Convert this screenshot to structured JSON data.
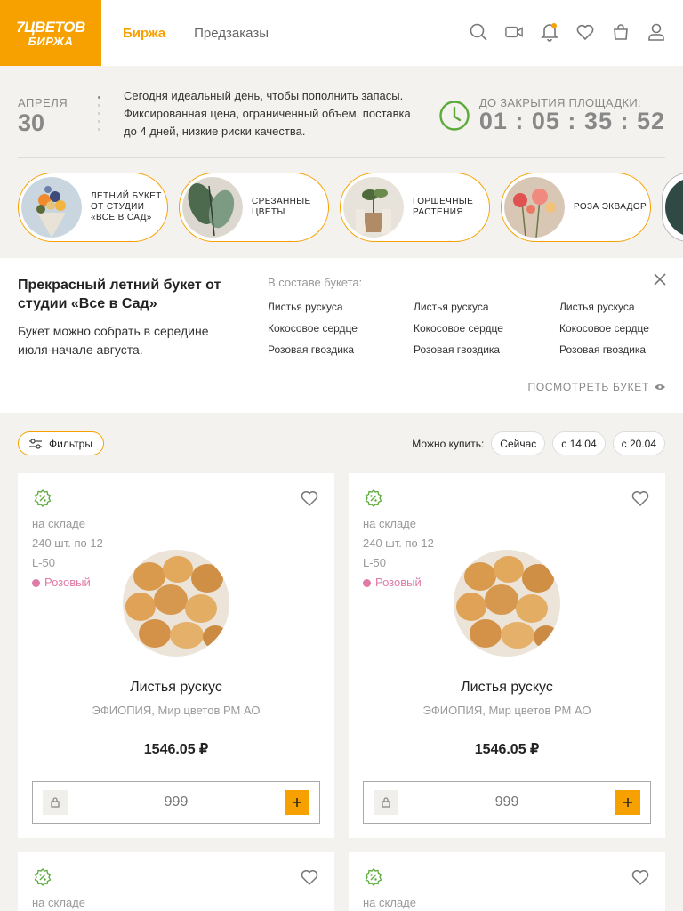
{
  "brand": {
    "line1": "7ЦВЕТОВ",
    "line2": "БИРЖА",
    "accent": "#f7a100"
  },
  "nav": {
    "tabs": [
      {
        "label": "Биржа",
        "active": true
      },
      {
        "label": "Предзаказы",
        "active": false
      }
    ]
  },
  "header_icons": [
    "search-icon",
    "video-icon",
    "bell-icon",
    "heart-icon",
    "cart-icon",
    "user-icon"
  ],
  "info": {
    "month": "АПРЕЛЯ",
    "day": "30",
    "description": "Сегодня идеальный день, чтобы пополнить запасы. Фиксированная цена, ограниченный объем, поставка до 4 дней, низкие риски качества.",
    "timer_label": "ДО ЗАКРЫТИЯ ПЛОЩАДКИ:",
    "timer_value": "01 : 05 : 35 : 52"
  },
  "categories": [
    {
      "label": "ЛЕТНИЙ БУКЕТ ОТ СТУДИИ «ВСЕ В САД»",
      "image": "bouquet"
    },
    {
      "label": "СРЕЗАННЫЕ ЦВЕТЫ",
      "image": "leaves"
    },
    {
      "label": "ГОРШЕЧНЫЕ РАСТЕНИЯ",
      "image": "potted-plant"
    },
    {
      "label": "РОЗА ЭКВАДОР",
      "image": "roses"
    }
  ],
  "bouquet": {
    "title": "Прекрасный летний букет от студии «Все в Сад»",
    "text": "Букет можно собрать в середине июля-начале августа.",
    "composition_label": "В составе букета:",
    "composition": [
      "Листья рускуса",
      "Листья рускуса",
      "Листья рускуса",
      "Кокосовое сердце",
      "Кокосовое сердце",
      "Кокосовое сердце",
      "Розовая гвоздика",
      "Розовая гвоздика",
      "Розовая гвоздика"
    ],
    "view_label": "ПОСМОТРЕТЬ БУКЕТ"
  },
  "filters": {
    "label": "Фильтры",
    "buy_label": "Можно купить:",
    "chips": [
      "Сейчас",
      "с 14.04",
      "с 20.04"
    ]
  },
  "products": [
    {
      "stock": "на складе",
      "pack": "240 шт. по 12",
      "size": "L-50",
      "color": "Розовый",
      "name": "Листья рускус",
      "origin": "ЭФИОПИЯ, Мир цветов РМ АО",
      "price": "1546.05 ₽",
      "qty": "999"
    },
    {
      "stock": "на складе",
      "pack": "240 шт. по 12",
      "size": "L-50",
      "color": "Розовый",
      "name": "Листья рускус",
      "origin": "ЭФИОПИЯ, Мир цветов РМ АО",
      "price": "1546.05 ₽",
      "qty": "999"
    },
    {
      "stock": "на складе"
    },
    {
      "stock": "на складе"
    }
  ]
}
